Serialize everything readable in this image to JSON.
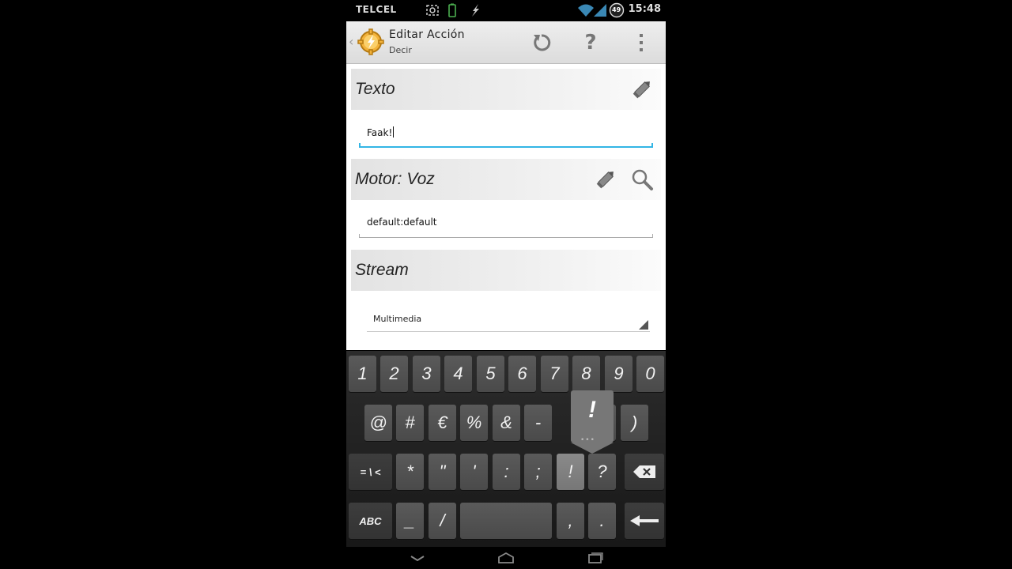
{
  "status_bar": {
    "carrier": "TELCEL",
    "battery_level": "49",
    "time": "15:48"
  },
  "action_bar": {
    "title": "Editar Acción",
    "subtitle": "Decir",
    "icons": [
      "app-icon",
      "undo-icon",
      "help-icon",
      "overflow-menu-icon"
    ]
  },
  "sections": {
    "texto": {
      "label": "Texto",
      "value": "Faak!"
    },
    "motor": {
      "label": "Motor: Voz",
      "value": "default:default"
    },
    "stream": {
      "label": "Stream",
      "value": "Multimedia"
    }
  },
  "keyboard": {
    "row1": [
      "1",
      "2",
      "3",
      "4",
      "5",
      "6",
      "7",
      "8",
      "9",
      "0"
    ],
    "row2": [
      "@",
      "#",
      "€",
      "%",
      "&",
      "-",
      "(",
      ")"
    ],
    "row3": [
      "= \\ <",
      "*",
      "\"",
      "'",
      ":",
      ";",
      "!",
      "?"
    ],
    "row4": [
      "ABC",
      "_",
      "/",
      ",",
      "."
    ],
    "popup_char": "!",
    "popup_dots": "•••"
  },
  "colors": {
    "focus_accent": "#33b5e5",
    "key_bg": "#4e4e4e",
    "action_bar_bg": "#e6e6e6"
  }
}
